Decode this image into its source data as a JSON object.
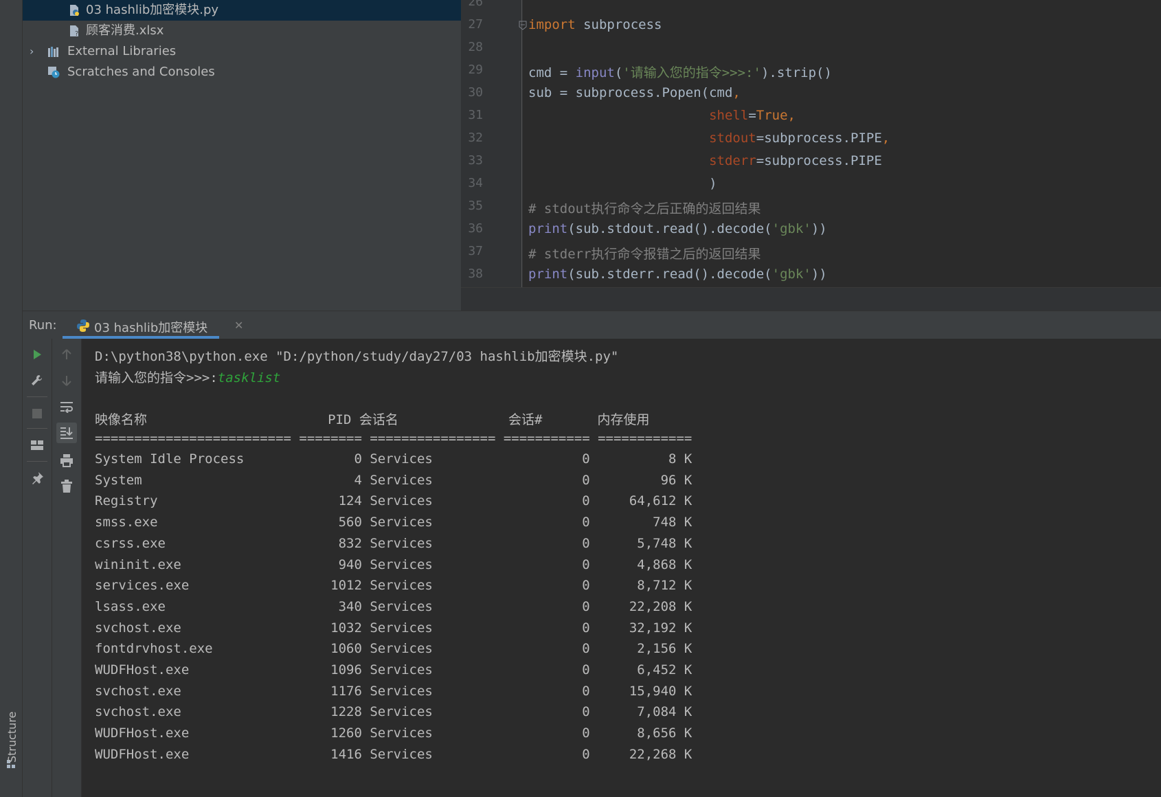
{
  "project_tree": {
    "items": [
      {
        "label": "03 hashlib加密模块.py",
        "icon": "python-file-icon",
        "selected": true
      },
      {
        "label": "顾客消费.xlsx",
        "icon": "unknown-file-icon",
        "selected": false
      },
      {
        "label": "External Libraries",
        "icon": "libraries-icon",
        "selected": false,
        "expandable": true
      },
      {
        "label": "Scratches and Consoles",
        "icon": "scratches-icon",
        "selected": false
      }
    ]
  },
  "editor": {
    "line_numbers": [
      "26",
      "27",
      "28",
      "29",
      "30",
      "31",
      "32",
      "33",
      "34",
      "35",
      "36",
      "37",
      "38"
    ],
    "lines": [
      {
        "segments": []
      },
      {
        "segments": [
          {
            "t": "import",
            "c": "kw"
          },
          {
            "t": " subprocess",
            "c": ""
          }
        ]
      },
      {
        "segments": []
      },
      {
        "segments": [
          {
            "t": "cmd = ",
            "c": ""
          },
          {
            "t": "input",
            "c": "fn"
          },
          {
            "t": "(",
            "c": ""
          },
          {
            "t": "'请输入您的指令>>>:'",
            "c": "str"
          },
          {
            "t": ").strip()",
            "c": ""
          }
        ]
      },
      {
        "segments": [
          {
            "t": "sub = subprocess.Popen(cmd",
            "c": ""
          },
          {
            "t": ",",
            "c": "kw"
          }
        ]
      },
      {
        "segments": [
          {
            "t": "                       ",
            "c": ""
          },
          {
            "t": "shell",
            "c": "par"
          },
          {
            "t": "=",
            "c": ""
          },
          {
            "t": "True",
            "c": "cst"
          },
          {
            "t": ",",
            "c": "kw"
          }
        ]
      },
      {
        "segments": [
          {
            "t": "                       ",
            "c": ""
          },
          {
            "t": "stdout",
            "c": "par"
          },
          {
            "t": "=subprocess.PIPE",
            "c": ""
          },
          {
            "t": ",",
            "c": "kw"
          }
        ]
      },
      {
        "segments": [
          {
            "t": "                       ",
            "c": ""
          },
          {
            "t": "stderr",
            "c": "par"
          },
          {
            "t": "=subprocess.PIPE",
            "c": ""
          }
        ]
      },
      {
        "segments": [
          {
            "t": "                       )",
            "c": ""
          }
        ]
      },
      {
        "segments": [
          {
            "t": "# stdout执行命令之后正确的返回结果",
            "c": "cm"
          }
        ]
      },
      {
        "segments": [
          {
            "t": "print",
            "c": "fn"
          },
          {
            "t": "(sub.stdout.read().decode(",
            "c": ""
          },
          {
            "t": "'gbk'",
            "c": "str"
          },
          {
            "t": "))",
            "c": ""
          }
        ]
      },
      {
        "segments": [
          {
            "t": "# stderr执行命令报错之后的返回结果",
            "c": "cm"
          }
        ]
      },
      {
        "segments": [
          {
            "t": "print",
            "c": "fn"
          },
          {
            "t": "(sub.stderr.read().decode(",
            "c": ""
          },
          {
            "t": "'gbk'",
            "c": "str"
          },
          {
            "t": "))",
            "c": ""
          }
        ]
      }
    ]
  },
  "run_panel": {
    "label": "Run:",
    "tab_name": "03 hashlib加密模块",
    "close_glyph": "✕"
  },
  "console": {
    "command_line": "D:\\python38\\python.exe \"D:/python/study/day27/03 hashlib加密模块.py\"",
    "prompt": "请输入您的指令>>>:",
    "user_input": "tasklist",
    "header": "映像名称                       PID 会话名              会话#       内存使用",
    "separator": "========================= ======== ================ =========== ============",
    "processes": [
      {
        "name": "System Idle Process",
        "pid": "0",
        "session": "Services",
        "num": "0",
        "mem": "8 K"
      },
      {
        "name": "System",
        "pid": "4",
        "session": "Services",
        "num": "0",
        "mem": "96 K"
      },
      {
        "name": "Registry",
        "pid": "124",
        "session": "Services",
        "num": "0",
        "mem": "64,612 K"
      },
      {
        "name": "smss.exe",
        "pid": "560",
        "session": "Services",
        "num": "0",
        "mem": "748 K"
      },
      {
        "name": "csrss.exe",
        "pid": "832",
        "session": "Services",
        "num": "0",
        "mem": "5,748 K"
      },
      {
        "name": "wininit.exe",
        "pid": "940",
        "session": "Services",
        "num": "0",
        "mem": "4,868 K"
      },
      {
        "name": "services.exe",
        "pid": "1012",
        "session": "Services",
        "num": "0",
        "mem": "8,712 K"
      },
      {
        "name": "lsass.exe",
        "pid": "340",
        "session": "Services",
        "num": "0",
        "mem": "22,208 K"
      },
      {
        "name": "svchost.exe",
        "pid": "1032",
        "session": "Services",
        "num": "0",
        "mem": "32,192 K"
      },
      {
        "name": "fontdrvhost.exe",
        "pid": "1060",
        "session": "Services",
        "num": "0",
        "mem": "2,156 K"
      },
      {
        "name": "WUDFHost.exe",
        "pid": "1096",
        "session": "Services",
        "num": "0",
        "mem": "6,452 K"
      },
      {
        "name": "svchost.exe",
        "pid": "1176",
        "session": "Services",
        "num": "0",
        "mem": "15,940 K"
      },
      {
        "name": "svchost.exe",
        "pid": "1228",
        "session": "Services",
        "num": "0",
        "mem": "7,084 K"
      },
      {
        "name": "WUDFHost.exe",
        "pid": "1260",
        "session": "Services",
        "num": "0",
        "mem": "8,656 K"
      },
      {
        "name": "WUDFHost.exe",
        "pid": "1416",
        "session": "Services",
        "num": "0",
        "mem": "22,268 K"
      }
    ]
  },
  "sidebar": {
    "structure_label": "Structure"
  },
  "colors": {
    "keyword": "#cc7832",
    "builtin": "#8888c6",
    "string": "#6a8759",
    "comment": "#808080",
    "param": "#aa4926",
    "user_input": "#2fa33b",
    "tab_underline": "#4a88c7",
    "selection": "#0d293e"
  }
}
